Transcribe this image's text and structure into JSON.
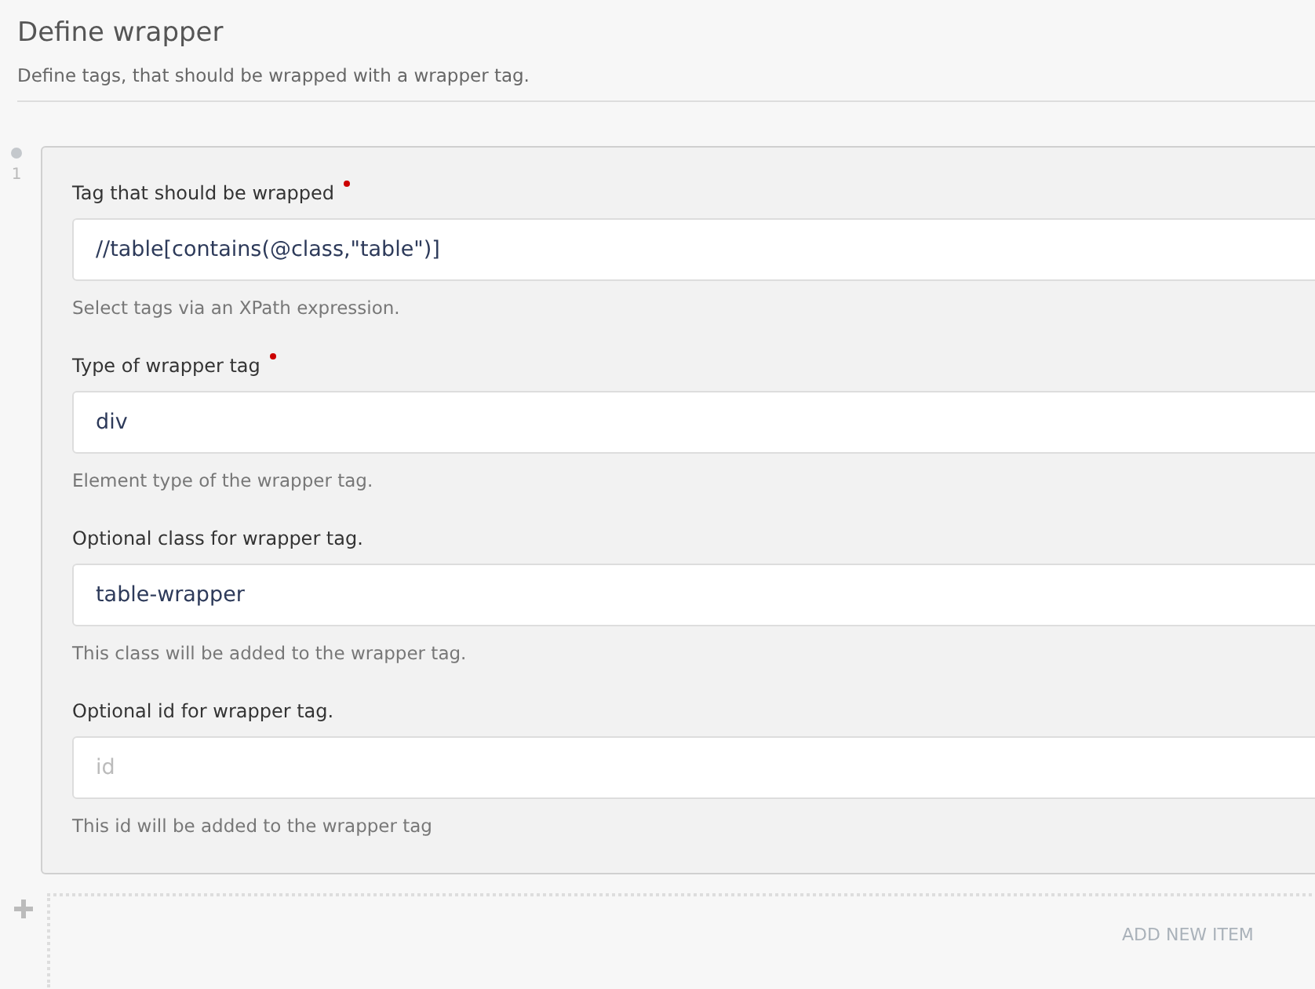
{
  "header": {
    "title": "Define wrapper",
    "description": "Define tags, that should be wrapped with a wrapper tag."
  },
  "items": [
    {
      "number": "1",
      "fields": [
        {
          "label": "Tag that should be wrapped",
          "required": true,
          "value": "//table[contains(@class,\"table\")]",
          "help": "Select tags via an XPath expression."
        },
        {
          "label": "Type of wrapper tag",
          "required": true,
          "value": "div",
          "help": "Element type of the wrapper tag."
        },
        {
          "label": "Optional class for wrapper tag.",
          "required": false,
          "value": "table-wrapper",
          "help": "This class will be added to the wrapper tag."
        },
        {
          "label": "Optional id for wrapper tag.",
          "required": false,
          "placeholder": "id",
          "help": "This id will be added to the wrapper tag"
        }
      ]
    }
  ],
  "add_item": {
    "label": "ADD NEW ITEM"
  }
}
